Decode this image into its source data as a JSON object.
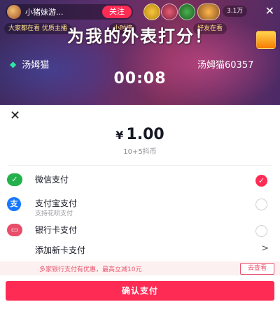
{
  "stream": {
    "host_name": "小猪妹游...",
    "follow_label": "关注",
    "viewer_count": "3.1万",
    "tags": [
      "大家都在看 优质主播",
      "小时榜",
      "好友在看"
    ],
    "title": "为我的外表打分！",
    "player_left": "汤姆猫",
    "player_right": "汤姆猫60357",
    "timer": "00:08"
  },
  "payment": {
    "close_icon": "close-icon",
    "currency": "¥",
    "amount": "1.00",
    "amount_detail": "10+5抖币",
    "methods": [
      {
        "icon": "wechat-pay-icon",
        "glyph": "✓",
        "label": "微信支付",
        "sub": "",
        "selected": true
      },
      {
        "icon": "alipay-icon",
        "glyph": "支",
        "label": "支付宝支付",
        "sub": "支持花呗支付",
        "selected": false
      },
      {
        "icon": "bank-card-icon",
        "glyph": "▭",
        "label": "银行卡支付",
        "sub": "",
        "selected": false
      }
    ],
    "add_card_label": "添加新卡支付",
    "add_card_chevron": ">",
    "promo_text": "多家银行支付有优惠，最高立减10元",
    "promo_button": "去查看",
    "confirm_button": "确认支付",
    "check_glyph": "✓",
    "colors": {
      "accent": "#fe2c55",
      "wechat": "#22b14c",
      "alipay": "#1677ff",
      "card": "#e84d6a",
      "promo_bg": "#fdf0f0"
    }
  }
}
